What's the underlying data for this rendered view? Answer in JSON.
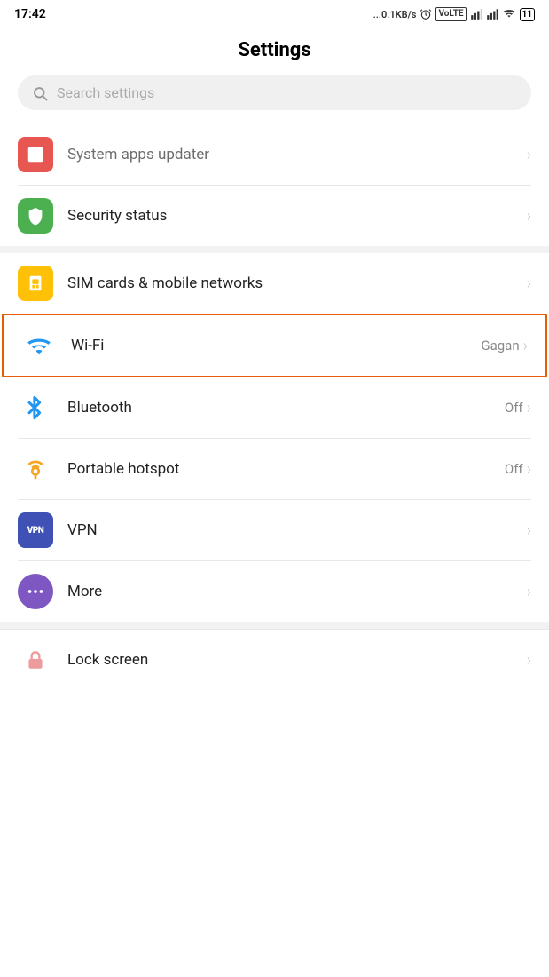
{
  "statusBar": {
    "time": "17:42",
    "network": "...0.1KB/s",
    "battery": "11"
  },
  "pageTitle": "Settings",
  "searchBar": {
    "placeholder": "Search settings"
  },
  "items": [
    {
      "id": "system-apps-updater",
      "label": "System apps updater",
      "value": "",
      "iconType": "red-square",
      "faded": true,
      "cutTop": true
    },
    {
      "id": "security-status",
      "label": "Security status",
      "value": "",
      "iconType": "green-shield",
      "faded": false
    },
    {
      "id": "sim-cards",
      "label": "SIM cards & mobile networks",
      "value": "",
      "iconType": "yellow-sim",
      "faded": false
    },
    {
      "id": "wifi",
      "label": "Wi-Fi",
      "value": "Gagan",
      "iconType": "wifi",
      "highlighted": true
    },
    {
      "id": "bluetooth",
      "label": "Bluetooth",
      "value": "Off",
      "iconType": "bluetooth"
    },
    {
      "id": "portable-hotspot",
      "label": "Portable hotspot",
      "value": "Off",
      "iconType": "hotspot"
    },
    {
      "id": "vpn",
      "label": "VPN",
      "value": "",
      "iconType": "vpn"
    },
    {
      "id": "more",
      "label": "More",
      "value": "",
      "iconType": "more"
    },
    {
      "id": "lock-screen",
      "label": "Lock screen",
      "value": "",
      "iconType": "lock",
      "cutBottom": true
    }
  ],
  "icons": {
    "search": "🔍",
    "chevron": "›"
  }
}
